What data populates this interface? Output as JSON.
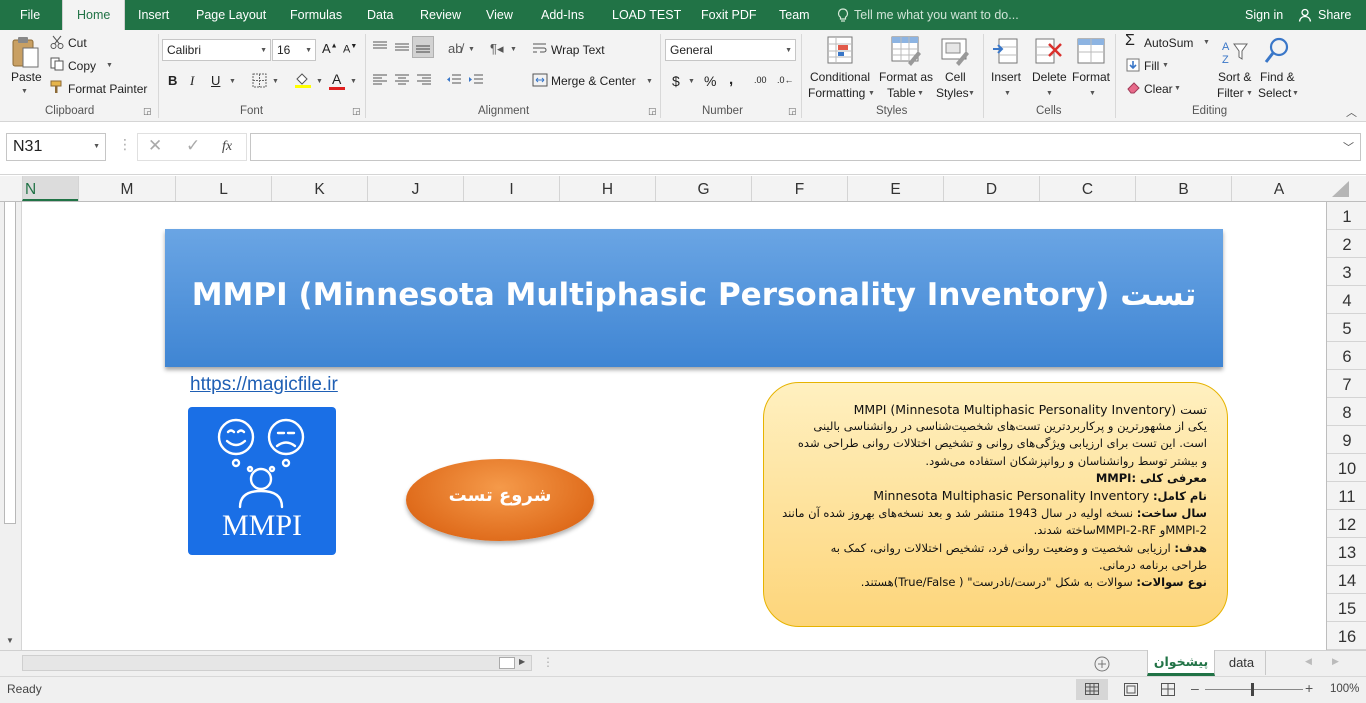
{
  "tabs": {
    "file": "File",
    "home": "Home",
    "insert": "Insert",
    "page_layout": "Page Layout",
    "formulas": "Formulas",
    "data": "Data",
    "review": "Review",
    "view": "View",
    "addins": "Add-Ins",
    "load_test": "LOAD TEST",
    "foxit": "Foxit PDF",
    "team": "Team",
    "tell_me": "Tell me what you want to do...",
    "sign_in": "Sign in",
    "share": "Share"
  },
  "ribbon": {
    "clipboard": {
      "paste": "Paste",
      "cut": "Cut",
      "copy": "Copy",
      "format_painter": "Format Painter",
      "label": "Clipboard"
    },
    "font": {
      "name": "Calibri",
      "size": "16",
      "bold": "B",
      "italic": "I",
      "underline": "U",
      "font_color": "A",
      "label": "Font"
    },
    "alignment": {
      "wrap": "Wrap Text",
      "merge": "Merge & Center",
      "label": "Alignment"
    },
    "number": {
      "format": "General",
      "currency": "$",
      "percent": "%",
      "comma": ",",
      "inc_dec": ".00",
      "label": "Number"
    },
    "styles": {
      "conditional": "Conditional",
      "formatting": "Formatting",
      "format_as": "Format as",
      "table": "Table",
      "cell": "Cell",
      "styles": "Styles",
      "label": "Styles"
    },
    "cells": {
      "insert": "Insert",
      "delete": "Delete",
      "format": "Format",
      "label": "Cells"
    },
    "editing": {
      "autosum": "AutoSum",
      "fill": "Fill",
      "clear": "Clear",
      "sort": "Sort &",
      "filter": "Filter",
      "find": "Find &",
      "select": "Select",
      "label": "Editing"
    }
  },
  "formula_bar": {
    "name_box": "N31",
    "fx": "fx",
    "formula": ""
  },
  "columns": [
    "N",
    "M",
    "L",
    "K",
    "J",
    "I",
    "H",
    "G",
    "F",
    "E",
    "D",
    "C",
    "B",
    "A"
  ],
  "rows": [
    "1",
    "2",
    "3",
    "4",
    "5",
    "6",
    "7",
    "8",
    "9",
    "10",
    "11",
    "12",
    "13",
    "14",
    "15",
    "16"
  ],
  "sheet": {
    "banner_title": "MMPI (Minnesota Multiphasic Personality Inventory) تست",
    "link": "https://magicfile.ir",
    "logo_text": "MMPI",
    "start_button": "شروع تست",
    "info": {
      "l1": "تست  MMPI (Minnesota Multiphasic Personality Inventory)",
      "l2": "یکی از مشهورترین و پرکاربردترین تست‌های شخصیت‌شناسی در روانشناسی بالینی",
      "l3": "است. این تست برای ارزیابی ویژگی‌های روانی و تشخیص اختلالات روانی طراحی شده",
      "l4": "و بیشتر توسط روانشناسان و روانپزشکان استفاده می‌شود.",
      "l5": "معرفی کلی :MMPI",
      "l6_label": "نام کامل:",
      "l6_value": "Minnesota Multiphasic Personality Inventory",
      "l7_label": "سال ساخت:",
      "l7_value": "نسخه اولیه در سال 1943 منتشر شد و بعد نسخه‌های بهروز شده آن مانند",
      "l8": "MMPI-2و MMPI-2-RFساخته شدند.",
      "l9_label": "هدف:",
      "l9_value": "ارزیابی شخصیت و وضعیت روانی فرد، تشخیص اختلالات روانی، کمک به",
      "l10": "طراحی برنامه درمانی.",
      "l11_label": "نوع سوالات:",
      "l11_value": "سوالات به شکل \"درست/نادرست\" ( True/False)هستند."
    }
  },
  "sheet_tabs": [
    "پیشخوان",
    "data"
  ],
  "status": {
    "ready": "Ready",
    "zoom": "100%"
  },
  "colors": {
    "excel_green": "#217346",
    "banner": "#4a8fd6",
    "logo_bg": "#1a6fe6",
    "button": "#ea7a2c",
    "info_bg": "#fdd57a"
  }
}
